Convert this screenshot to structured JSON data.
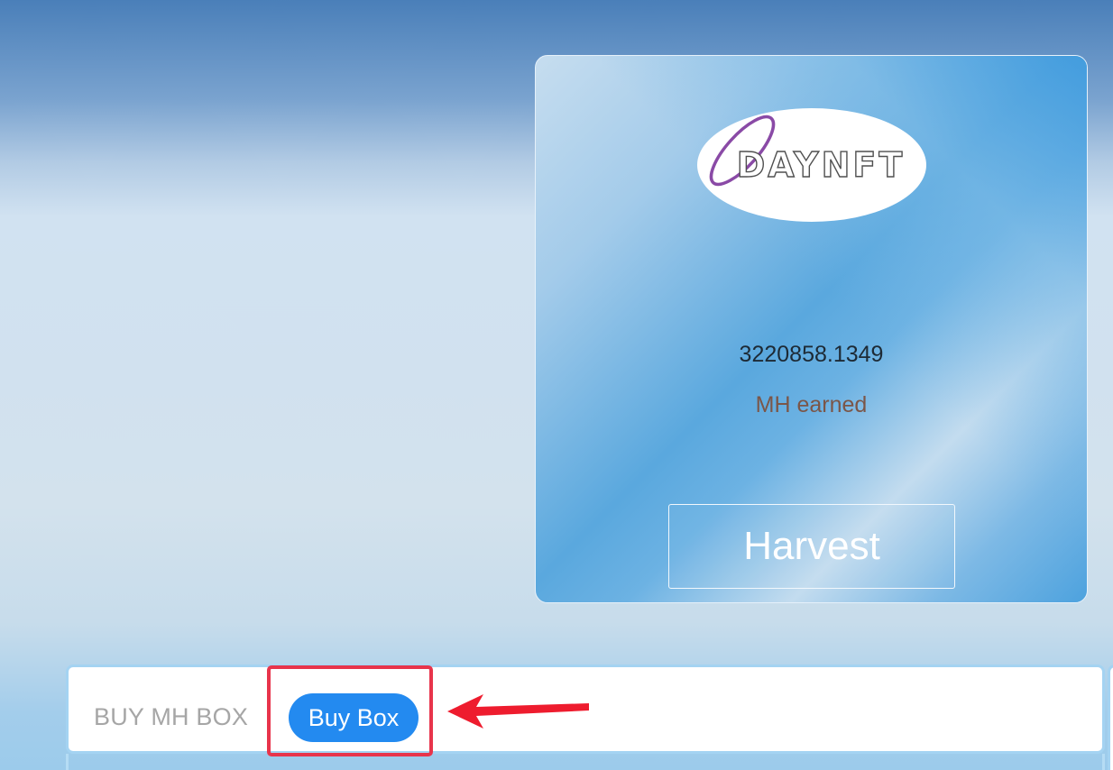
{
  "card": {
    "logo_text": "DAYNFT",
    "amount": "3220858.1349",
    "amount_label": "MH earned",
    "harvest_label": "Harvest"
  },
  "buy_section": {
    "title": "BUY MH BOX",
    "buy_button_label": "Buy Box"
  },
  "colors": {
    "button_blue": "#238af0",
    "highlight_red": "#e8344b",
    "earned_brown": "#7b5648",
    "logo_purple": "#8a4aa6"
  },
  "icons": {
    "annotation_arrow": "arrow-left-icon"
  }
}
